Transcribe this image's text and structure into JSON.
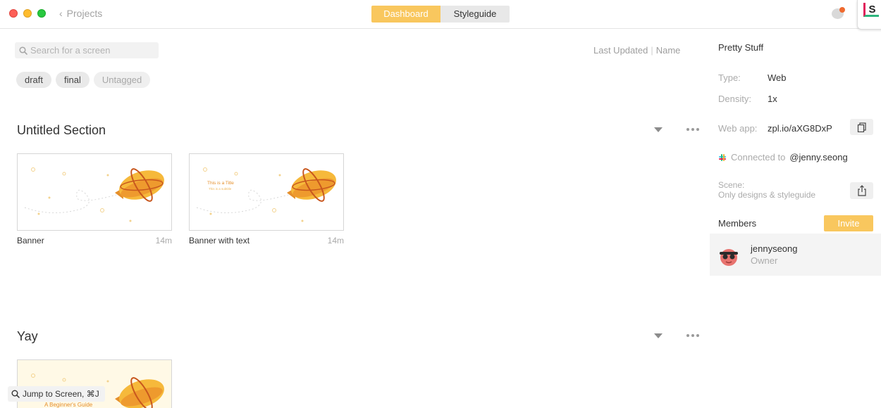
{
  "titlebar": {
    "back_label": "Projects",
    "tabs": [
      {
        "label": "Dashboard",
        "active": true
      },
      {
        "label": "Styleguide",
        "active": false
      }
    ],
    "notification_icon": "chat-bubble-icon",
    "slack_badge_letter": "S"
  },
  "toolbar": {
    "search_placeholder": "Search for a screen",
    "sort_last_updated": "Last Updated",
    "sort_separator": "|",
    "sort_name": "Name"
  },
  "tags": [
    "draft",
    "final",
    "Untagged"
  ],
  "sections": [
    {
      "title": "Untitled Section",
      "screens": [
        {
          "name": "Banner",
          "time": "14m",
          "thumb_title": "",
          "thumb_subtitle": ""
        },
        {
          "name": "Banner with text",
          "time": "14m",
          "thumb_title": "This is a Title",
          "thumb_subtitle": "This is a subtitle"
        }
      ]
    },
    {
      "title": "Yay",
      "screens": [
        {
          "name": "",
          "time": "",
          "thumb_title": "A Beginner's Guide",
          "thumb_subtitle": ""
        }
      ]
    }
  ],
  "jump": {
    "label": "Jump to Screen, ⌘J"
  },
  "panel": {
    "project_name": "Pretty Stuff",
    "type_key": "Type:",
    "type_value": "Web",
    "density_key": "Density:",
    "density_value": "1x",
    "webapp_key": "Web app:",
    "webapp_value": "zpl.io/aXG8DxP",
    "connected_prefix": "Connected to",
    "connected_user": "@jenny.seong",
    "scene_key": "Scene:",
    "scene_value": "Only designs & styleguide",
    "members_label": "Members",
    "invite_label": "Invite",
    "members": [
      {
        "name": "jennyseong",
        "role": "Owner"
      }
    ]
  },
  "colors": {
    "accent": "#f9c75e",
    "zeppelin_orange": "#f2a63a",
    "notification_dot": "#ef6a2f"
  }
}
